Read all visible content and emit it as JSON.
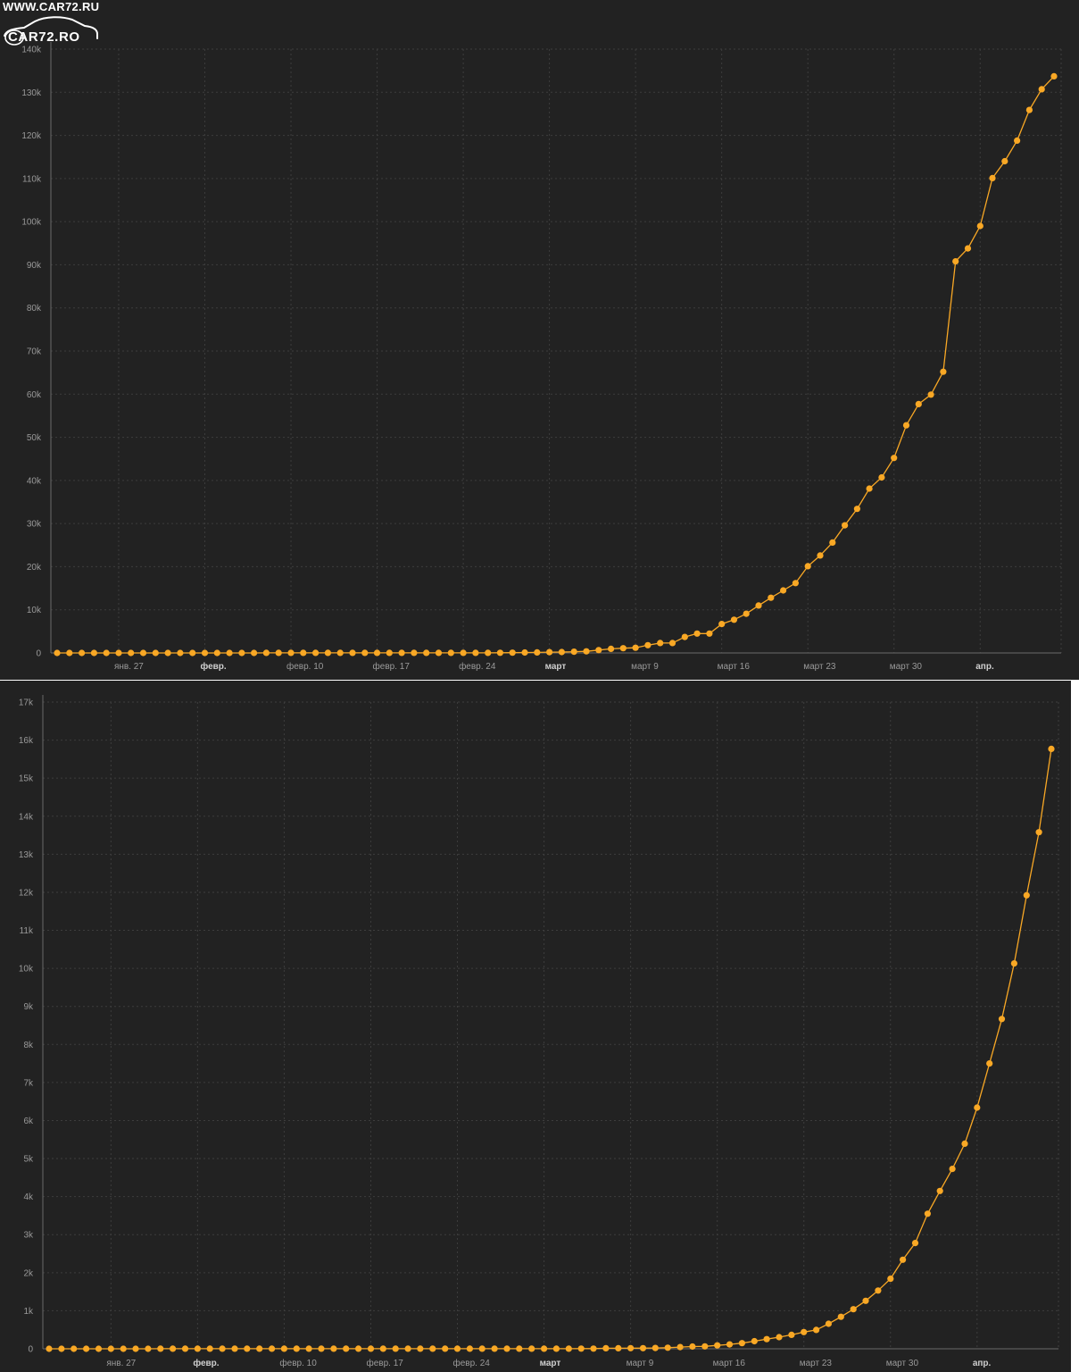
{
  "watermark": {
    "url_text": "WWW.CAR72.RU",
    "logo_text": "CAR72.RO"
  },
  "colors": {
    "background": "#222222",
    "series": "#F9A825",
    "grid": "#3d3d3d",
    "axis_text": "#9a9a9a"
  },
  "chart_data": [
    {
      "type": "line",
      "grid": true,
      "markers": true,
      "ylim": [
        0,
        140000
      ],
      "x": [
        "01-22",
        "01-23",
        "01-24",
        "01-25",
        "01-26",
        "01-27",
        "01-28",
        "01-29",
        "01-30",
        "01-31",
        "02-01",
        "02-02",
        "02-03",
        "02-04",
        "02-05",
        "02-06",
        "02-07",
        "02-08",
        "02-09",
        "02-10",
        "02-11",
        "02-12",
        "02-13",
        "02-14",
        "02-15",
        "02-16",
        "02-17",
        "02-18",
        "02-19",
        "02-20",
        "02-21",
        "02-22",
        "02-23",
        "02-24",
        "02-25",
        "02-26",
        "02-27",
        "02-28",
        "02-29",
        "03-01",
        "03-02",
        "03-03",
        "03-04",
        "03-05",
        "03-06",
        "03-07",
        "03-08",
        "03-09",
        "03-10",
        "03-11",
        "03-12",
        "03-13",
        "03-14",
        "03-15",
        "03-16",
        "03-17",
        "03-18",
        "03-19",
        "03-20",
        "03-21",
        "03-22",
        "03-23",
        "03-24",
        "03-25",
        "03-26",
        "03-27",
        "03-28",
        "03-29",
        "03-30",
        "03-31",
        "04-01",
        "04-02",
        "04-03",
        "04-04",
        "04-05",
        "04-06",
        "04-07",
        "04-08",
        "04-09",
        "04-10",
        "04-11",
        "04-12"
      ],
      "series": [
        {
          "values": [
            0,
            0,
            2,
            3,
            3,
            3,
            4,
            5,
            5,
            5,
            6,
            6,
            6,
            6,
            6,
            6,
            6,
            11,
            11,
            11,
            11,
            11,
            11,
            11,
            12,
            12,
            12,
            12,
            12,
            12,
            12,
            12,
            12,
            12,
            14,
            18,
            38,
            57,
            100,
            130,
            191,
            204,
            288,
            380,
            656,
            959,
            1100,
            1200,
            1800,
            2300,
            2300,
            3700,
            4500,
            4500,
            6700,
            7700,
            9100,
            11000,
            12800,
            14500,
            16200,
            20100,
            22600,
            25600,
            29600,
            33400,
            38100,
            40700,
            45200,
            52800,
            57700,
            59900,
            65200,
            90800,
            93800,
            99000,
            110100,
            114000,
            118800,
            125900,
            130700,
            133700
          ]
        }
      ],
      "y_ticks": [
        {
          "value": 0,
          "label": "0"
        },
        {
          "value": 10000,
          "label": "10k"
        },
        {
          "value": 20000,
          "label": "20k"
        },
        {
          "value": 30000,
          "label": "30k"
        },
        {
          "value": 40000,
          "label": "40k"
        },
        {
          "value": 50000,
          "label": "50k"
        },
        {
          "value": 60000,
          "label": "60k"
        },
        {
          "value": 70000,
          "label": "70k"
        },
        {
          "value": 80000,
          "label": "80k"
        },
        {
          "value": 90000,
          "label": "90k"
        },
        {
          "value": 100000,
          "label": "100k"
        },
        {
          "value": 110000,
          "label": "110k"
        },
        {
          "value": 120000,
          "label": "120k"
        },
        {
          "value": 130000,
          "label": "130k"
        },
        {
          "value": 140000,
          "label": "140k"
        }
      ],
      "x_ticks": [
        {
          "x": "01-27",
          "label": "янв. 27"
        },
        {
          "x": "02-03",
          "label": "февр."
        },
        {
          "x": "02-10",
          "label": "февр. 10"
        },
        {
          "x": "02-17",
          "label": "февр. 17"
        },
        {
          "x": "02-24",
          "label": "февр. 24"
        },
        {
          "x": "03-02",
          "label": "март"
        },
        {
          "x": "03-09",
          "label": "март 9"
        },
        {
          "x": "03-16",
          "label": "март 16"
        },
        {
          "x": "03-23",
          "label": "март 23"
        },
        {
          "x": "03-30",
          "label": "март 30"
        },
        {
          "x": "04-06",
          "label": "апр."
        }
      ]
    },
    {
      "type": "line",
      "grid": true,
      "markers": true,
      "ylim": [
        0,
        17000
      ],
      "x": [
        "01-22",
        "01-23",
        "01-24",
        "01-25",
        "01-26",
        "01-27",
        "01-28",
        "01-29",
        "01-30",
        "01-31",
        "02-01",
        "02-02",
        "02-03",
        "02-04",
        "02-05",
        "02-06",
        "02-07",
        "02-08",
        "02-09",
        "02-10",
        "02-11",
        "02-12",
        "02-13",
        "02-14",
        "02-15",
        "02-16",
        "02-17",
        "02-18",
        "02-19",
        "02-20",
        "02-21",
        "02-22",
        "02-23",
        "02-24",
        "02-25",
        "02-26",
        "02-27",
        "02-28",
        "02-29",
        "03-01",
        "03-02",
        "03-03",
        "03-04",
        "03-05",
        "03-06",
        "03-07",
        "03-08",
        "03-09",
        "03-10",
        "03-11",
        "03-12",
        "03-13",
        "03-14",
        "03-15",
        "03-16",
        "03-17",
        "03-18",
        "03-19",
        "03-20",
        "03-21",
        "03-22",
        "03-23",
        "03-24",
        "03-25",
        "03-26",
        "03-27",
        "03-28",
        "03-29",
        "03-30",
        "03-31",
        "04-01",
        "04-02",
        "04-03",
        "04-04",
        "04-05",
        "04-06",
        "04-07",
        "04-08",
        "04-09",
        "04-10",
        "04-11",
        "04-12"
      ],
      "series": [
        {
          "values": [
            0,
            0,
            0,
            0,
            0,
            0,
            0,
            0,
            0,
            2,
            2,
            2,
            2,
            2,
            2,
            2,
            2,
            2,
            2,
            2,
            2,
            2,
            2,
            2,
            2,
            2,
            2,
            2,
            2,
            2,
            2,
            2,
            2,
            2,
            2,
            2,
            2,
            2,
            2,
            2,
            3,
            3,
            3,
            4,
            4,
            13,
            13,
            17,
            17,
            20,
            28,
            45,
            59,
            63,
            90,
            114,
            147,
            199,
            253,
            306,
            367,
            438,
            495,
            658,
            840,
            1040,
            1260,
            1530,
            1840,
            2340,
            2780,
            3550,
            4150,
            4730,
            5390,
            6340,
            7500,
            8670,
            10130,
            11920,
            13580,
            15770
          ]
        }
      ],
      "y_ticks": [
        {
          "value": 0,
          "label": "0"
        },
        {
          "value": 1000,
          "label": "1k"
        },
        {
          "value": 2000,
          "label": "2k"
        },
        {
          "value": 3000,
          "label": "3k"
        },
        {
          "value": 4000,
          "label": "4k"
        },
        {
          "value": 5000,
          "label": "5k"
        },
        {
          "value": 6000,
          "label": "6k"
        },
        {
          "value": 7000,
          "label": "7k"
        },
        {
          "value": 8000,
          "label": "8k"
        },
        {
          "value": 9000,
          "label": "9k"
        },
        {
          "value": 10000,
          "label": "10k"
        },
        {
          "value": 11000,
          "label": "11k"
        },
        {
          "value": 12000,
          "label": "12k"
        },
        {
          "value": 13000,
          "label": "13k"
        },
        {
          "value": 14000,
          "label": "14k"
        },
        {
          "value": 15000,
          "label": "15k"
        },
        {
          "value": 16000,
          "label": "16k"
        },
        {
          "value": 17000,
          "label": "17k"
        }
      ],
      "x_ticks": [
        {
          "x": "01-27",
          "label": "янв. 27"
        },
        {
          "x": "02-03",
          "label": "февр."
        },
        {
          "x": "02-10",
          "label": "февр. 10"
        },
        {
          "x": "02-17",
          "label": "февр. 17"
        },
        {
          "x": "02-24",
          "label": "февр. 24"
        },
        {
          "x": "03-02",
          "label": "март"
        },
        {
          "x": "03-09",
          "label": "март 9"
        },
        {
          "x": "03-16",
          "label": "март 16"
        },
        {
          "x": "03-23",
          "label": "март 23"
        },
        {
          "x": "03-30",
          "label": "март 30"
        },
        {
          "x": "04-06",
          "label": "апр."
        }
      ]
    }
  ]
}
